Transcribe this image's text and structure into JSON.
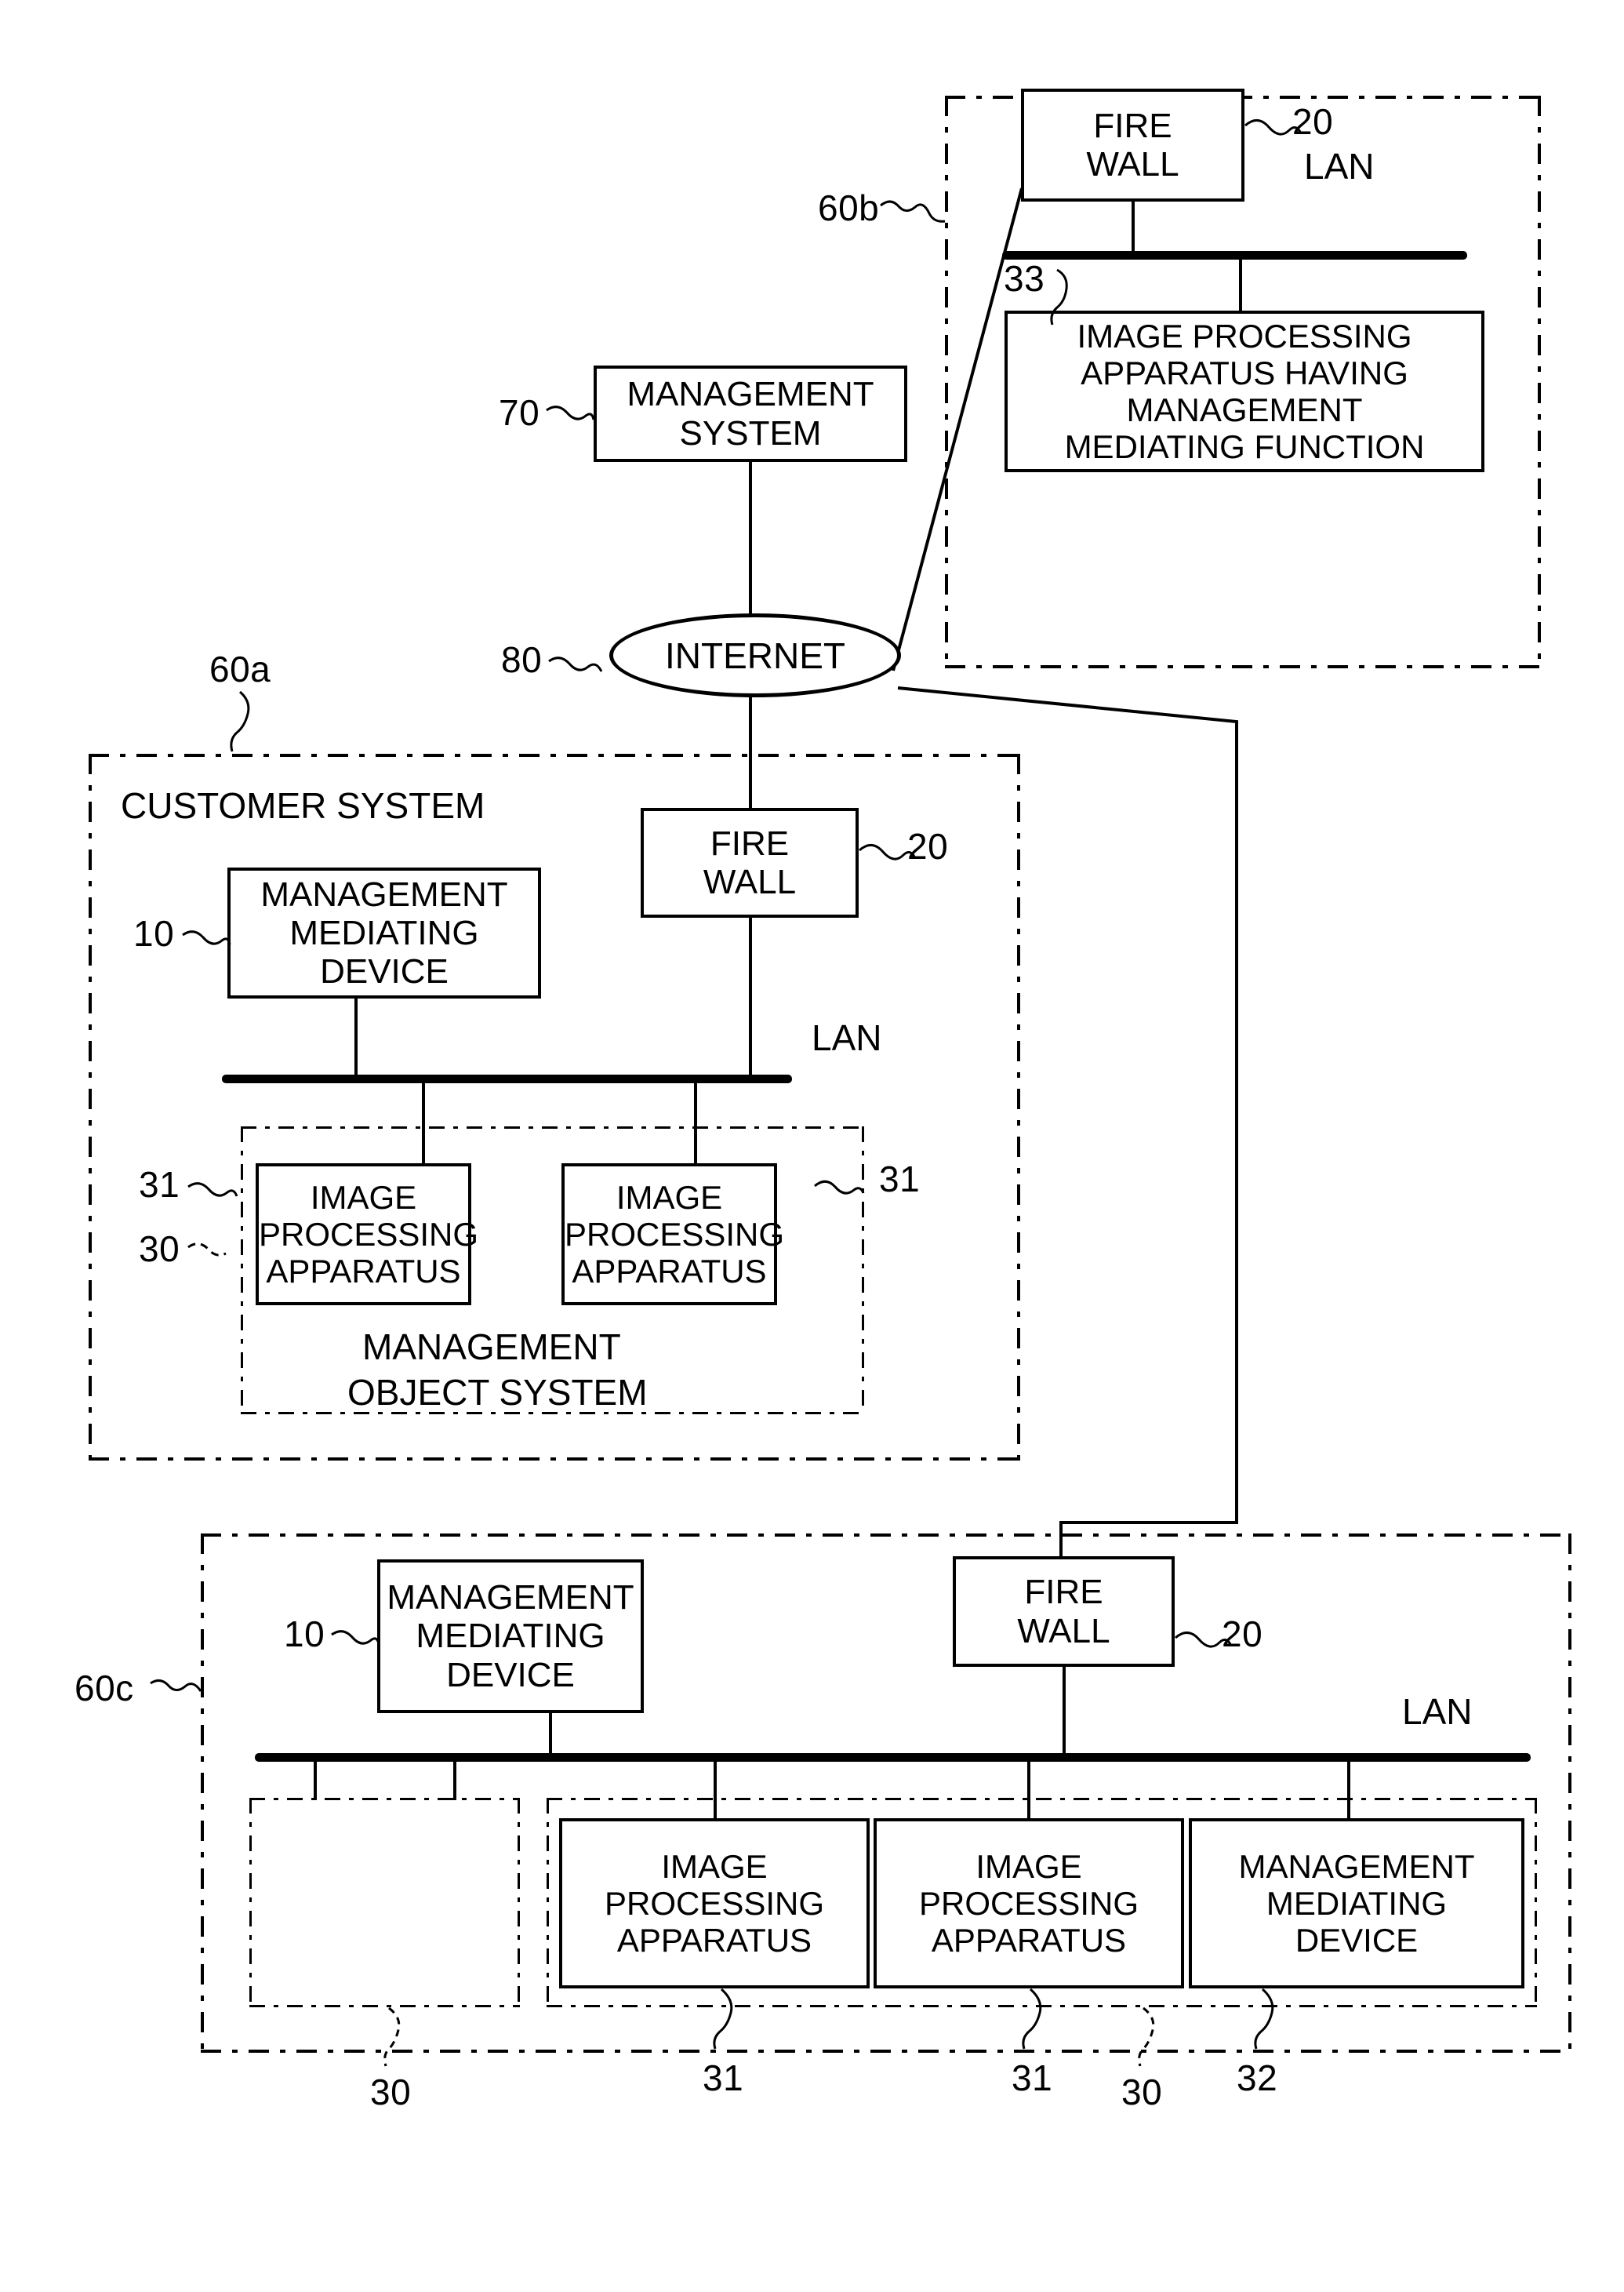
{
  "figure": {
    "type": "patent-network-diagram",
    "background_color": "#ffffff",
    "line_color": "#000000"
  },
  "labels": {
    "lan": "LAN",
    "internet": "INTERNET",
    "fire_wall": "FIRE\nWALL",
    "fire_wall_line1": "FIRE",
    "fire_wall_line2": "WALL",
    "management_system_line1": "MANAGEMENT",
    "management_system_line2": "SYSTEM",
    "management_mediating_device_line1": "MANAGEMENT",
    "management_mediating_device_line2": "MEDIATING",
    "management_mediating_device_line3": "DEVICE",
    "image_processing_apparatus_line1": "IMAGE",
    "image_processing_apparatus_line2": "PROCESSING",
    "image_processing_apparatus_line3": "APPARATUS",
    "customer_system": "CUSTOMER SYSTEM",
    "management_object_system_line1": "MANAGEMENT",
    "management_object_system_line2": "OBJECT SYSTEM",
    "ipa_having_mmf_line1": "IMAGE PROCESSING",
    "ipa_having_mmf_line2": "APPARATUS HAVING",
    "ipa_having_mmf_line3": "MANAGEMENT",
    "ipa_having_mmf_line4": "MEDIATING FUNCTION"
  },
  "reference_numerals": {
    "system_60a": "60a",
    "system_60b": "60b",
    "system_60c": "60c",
    "management_system": "70",
    "internet": "80",
    "management_mediating_device": "10",
    "fire_wall": "20",
    "management_object_system": "30",
    "image_processing_apparatus": "31",
    "management_mediating_device_inner": "32",
    "image_processing_apparatus_having_mmf": "33"
  },
  "systems": {
    "system_60b": {
      "ref": "60b",
      "nodes": [
        {
          "name": "fire-wall",
          "ref": "20",
          "label_lines": [
            "FIRE",
            "WALL"
          ]
        },
        {
          "name": "image-processing-apparatus-having-management-mediating-function",
          "ref": "33",
          "label_lines": [
            "IMAGE PROCESSING",
            "APPARATUS HAVING",
            "MANAGEMENT",
            "MEDIATING FUNCTION"
          ]
        }
      ],
      "network": "LAN"
    },
    "system_60a": {
      "ref": "60a",
      "title": "CUSTOMER SYSTEM",
      "nodes": [
        {
          "name": "management-mediating-device",
          "ref": "10",
          "label_lines": [
            "MANAGEMENT",
            "MEDIATING",
            "DEVICE"
          ]
        },
        {
          "name": "fire-wall",
          "ref": "20",
          "label_lines": [
            "FIRE",
            "WALL"
          ]
        },
        {
          "name": "image-processing-apparatus",
          "ref": "31",
          "label_lines": [
            "IMAGE",
            "PROCESSING",
            "APPARATUS"
          ]
        },
        {
          "name": "image-processing-apparatus",
          "ref": "31",
          "label_lines": [
            "IMAGE",
            "PROCESSING",
            "APPARATUS"
          ]
        }
      ],
      "network": "LAN",
      "subgroup": {
        "ref": "30",
        "title_lines": [
          "MANAGEMENT",
          "OBJECT SYSTEM"
        ]
      }
    },
    "system_60c": {
      "ref": "60c",
      "nodes": [
        {
          "name": "management-mediating-device",
          "ref": "10",
          "label_lines": [
            "MANAGEMENT",
            "MEDIATING",
            "DEVICE"
          ]
        },
        {
          "name": "fire-wall",
          "ref": "20",
          "label_lines": [
            "FIRE",
            "WALL"
          ]
        },
        {
          "name": "image-processing-apparatus",
          "ref": "31",
          "label_lines": [
            "IMAGE",
            "PROCESSING",
            "APPARATUS"
          ]
        },
        {
          "name": "image-processing-apparatus",
          "ref": "31",
          "label_lines": [
            "IMAGE",
            "PROCESSING",
            "APPARATUS"
          ]
        },
        {
          "name": "management-mediating-device",
          "ref": "32",
          "label_lines": [
            "MANAGEMENT",
            "MEDIATING",
            "DEVICE"
          ]
        }
      ],
      "network": "LAN",
      "subgroups": [
        {
          "ref": "30",
          "empty": true
        },
        {
          "ref": "30",
          "empty": false
        }
      ]
    }
  },
  "standalone": {
    "management_system": {
      "ref": "70",
      "label_lines": [
        "MANAGEMENT",
        "SYSTEM"
      ]
    },
    "internet": {
      "ref": "80",
      "label": "INTERNET"
    }
  }
}
